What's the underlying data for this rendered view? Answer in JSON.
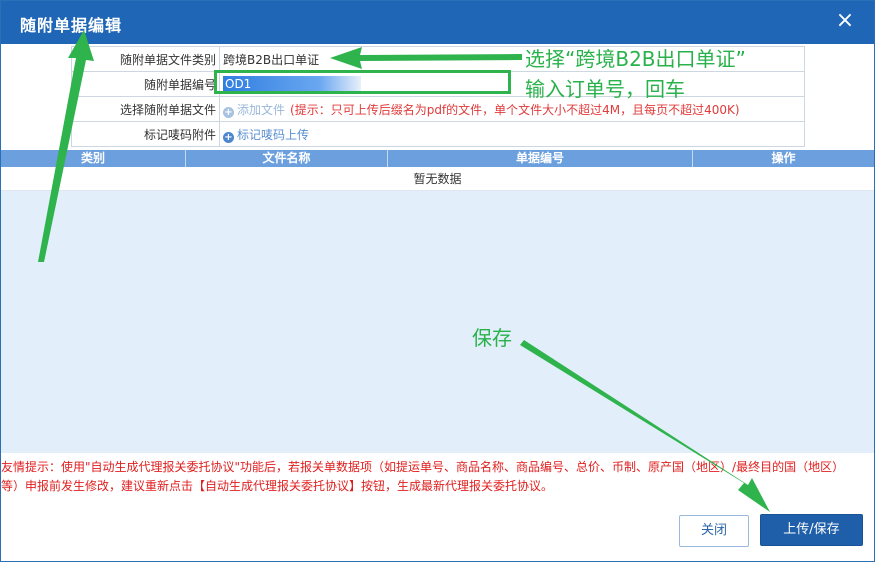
{
  "window": {
    "title": "随附单据编辑",
    "close_glyph": "×"
  },
  "form": {
    "rows": [
      {
        "label": "随附单据文件类别",
        "value": "跨境B2B出口单证"
      },
      {
        "label": "随附单据编号",
        "input_value": "OD1"
      },
      {
        "label": "选择随附单据文件",
        "link": "添加文件",
        "hint": "(提示：只可上传后缀名为pdf的文件，单个文件大小不超过4M，且每页不超过400K)"
      },
      {
        "label": "标记唛码附件",
        "link": "标记唛码上传"
      }
    ],
    "plus_glyph": "+"
  },
  "grid": {
    "columns": [
      "类别",
      "文件名称",
      "单据编号",
      "操作"
    ],
    "empty_text": "暂无数据"
  },
  "tip": {
    "line1": "友情提示：使用\"自动生成代理报关委托协议\"功能后，若报关单数据项（如提运单号、商品名称、商品编号、总价、币制、原产国（地区）/最终目的国（地区）",
    "line2": "等）申报前发生修改，建议重新点击【自动生成代理报关委托协议】按钮，生成最新代理报关委托协议。"
  },
  "buttons": {
    "close": "关闭",
    "save": "上传/保存"
  },
  "annotations": {
    "select_type": "选择“跨境B2B出口单证”",
    "enter_number": "输入订单号，回车",
    "save": "保存"
  },
  "colors": {
    "title_bar": "#1f66b6",
    "annotation": "#29b24b",
    "hint": "#e03a3a",
    "grid_header": "#6b9fdd"
  }
}
